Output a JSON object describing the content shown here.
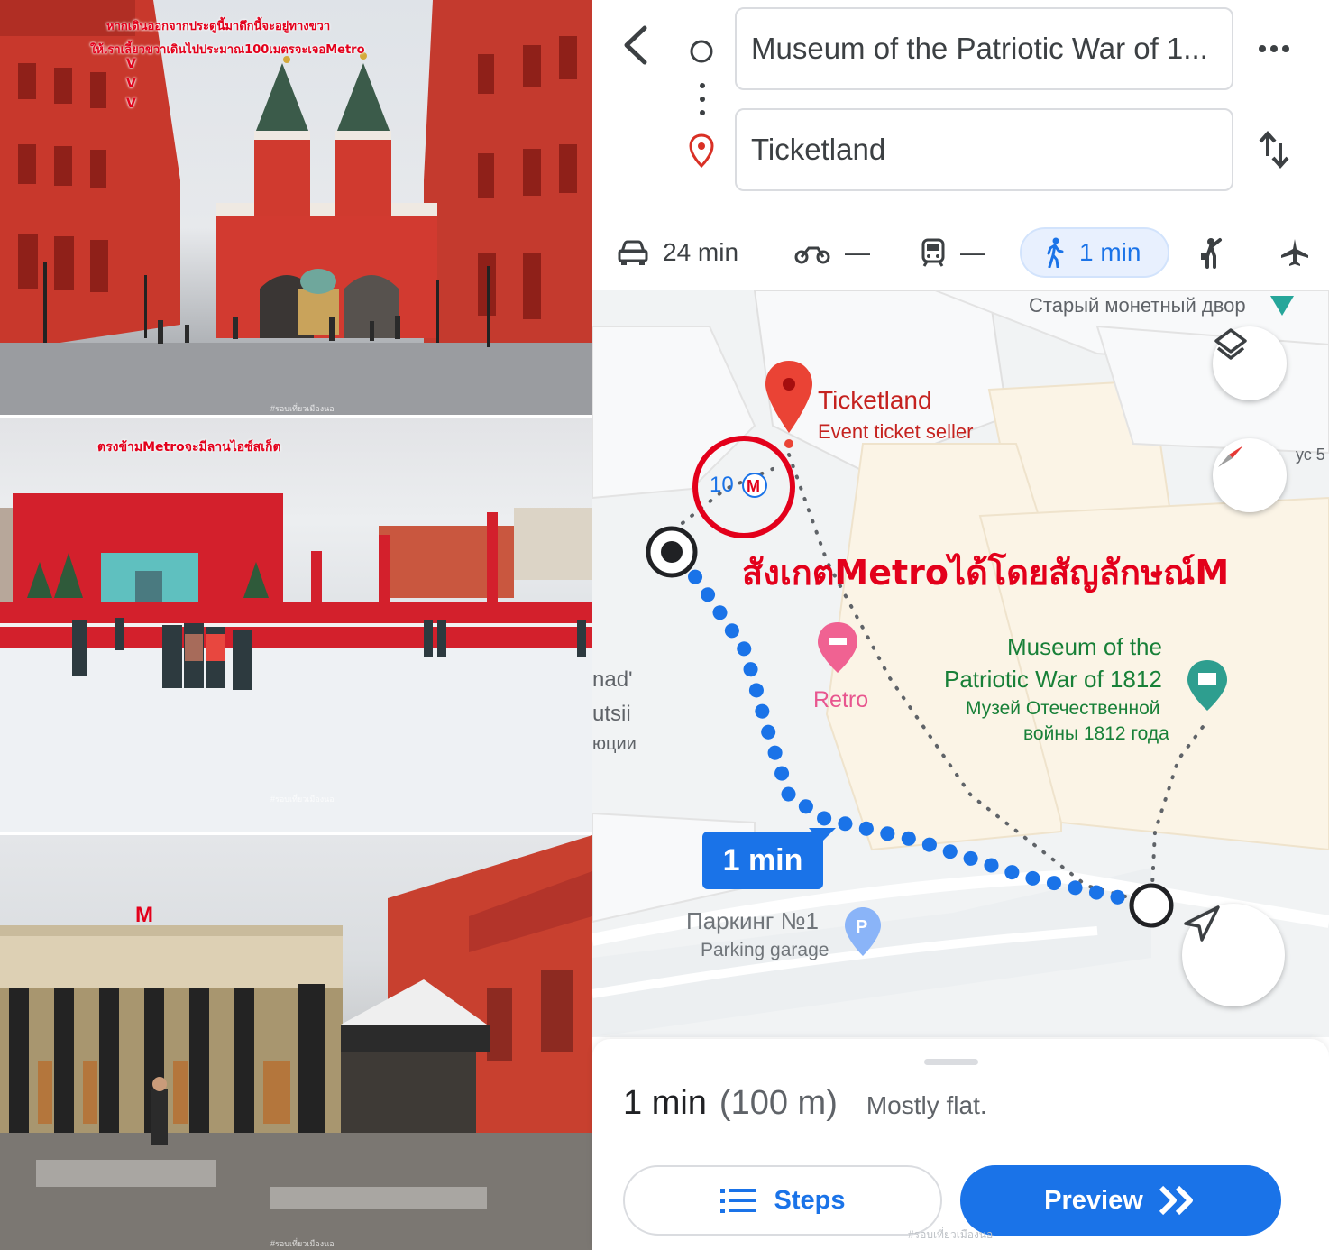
{
  "photos": {
    "photo1": {
      "caption_line1": "หากเดินออกจากประตูนี้มาตึกนี้จะอยู่ทางขวา",
      "caption_line2": "ให้เราเลี้ยวขวาเดินไปประมาณ100เมตรจะเจอMetro",
      "arrows": "V\nV\nV",
      "watermark": "#รอบเที่ยวเมืองนอ"
    },
    "photo2": {
      "caption": "ตรงข้ามMetroจะมีลานไอซ์สเก็ต",
      "watermark": "#รอบเที่ยวเมืองนอ"
    },
    "photo3": {
      "watermark": "#รอบเที่ยวเมืองนอ"
    }
  },
  "maps": {
    "origin": "Museum of the Patriotic War of 1...",
    "destination": "Ticketland",
    "modes": {
      "car": "24 min",
      "motorcycle": "—",
      "transit": "—",
      "walk": "1 min"
    },
    "map_labels": {
      "mint": "Старый монетный двор",
      "ticketland": "Ticketland",
      "ticketland_sub": "Event ticket seller",
      "metro_number": "10",
      "retro": "Retro",
      "museum_line1": "Museum of the",
      "museum_line2": "Patriotic War of 1812",
      "museum_ru1": "Музей Отечественной",
      "museum_ru2": "войны 1812 года",
      "left1": "nad'",
      "left2": "utsii",
      "left3": "юции",
      "edge": "ус 5",
      "parking1": "Паркинг №1",
      "parking2": "Parking garage"
    },
    "annotation": "สังเกตMetroได้โดยสัญลักษณ์M",
    "route_time_chip": "1 min",
    "summary": {
      "time": "1 min",
      "distance": "(100 m)",
      "terrain": "Mostly flat."
    },
    "buttons": {
      "steps": "Steps",
      "preview": "Preview"
    },
    "sheet_watermark": "#รอบเที่ยวเมืองนอ"
  },
  "colors": {
    "accent_blue": "#1a73e8",
    "annotation_red": "#e3001b",
    "pin_red": "#ea4335",
    "museum_green": "#188038",
    "retro_pink": "#e8568f"
  }
}
